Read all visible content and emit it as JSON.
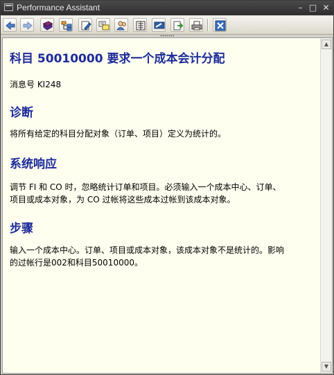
{
  "window": {
    "title": "Performance Assistant"
  },
  "toolbar": {
    "buttons": [
      {
        "icon": "back-arrow-icon"
      },
      {
        "icon": "forward-arrow-icon"
      },
      {
        "icon": "book-icon"
      },
      {
        "icon": "structure-icon"
      },
      {
        "icon": "edit-icon"
      },
      {
        "icon": "technical-info-icon"
      },
      {
        "icon": "users-icon"
      },
      {
        "icon": "document-icon"
      },
      {
        "icon": "display-icon"
      },
      {
        "icon": "export-icon"
      },
      {
        "icon": "print-icon"
      },
      {
        "icon": "close-icon"
      }
    ]
  },
  "message": {
    "title": "科目  50010000 要求一个成本会计分配",
    "message_number": "消息号  KI248",
    "sections": [
      {
        "heading": "诊断",
        "lines": [
          "将所有给定的科目分配对象（订单、项目）定义为统计的。"
        ]
      },
      {
        "heading": "系统响应",
        "lines": [
          "调节  FI 和  CO 时，忽略统计订单和项目。必须输入一个成本中心、订单、",
          "项目或成本对象，为  CO 过帐将这些成本过帐到该成本对象。"
        ]
      },
      {
        "heading": "步骤",
        "lines": [
          "输入一个成本中心。订单、项目或成本对象，该成本对象不是统计的。影响",
          "的过帐行是002和科目50010000。"
        ]
      }
    ]
  },
  "colors": {
    "heading": "#1c2a9a",
    "background": "#fffff0",
    "titlebar": "#2e2e2e"
  }
}
